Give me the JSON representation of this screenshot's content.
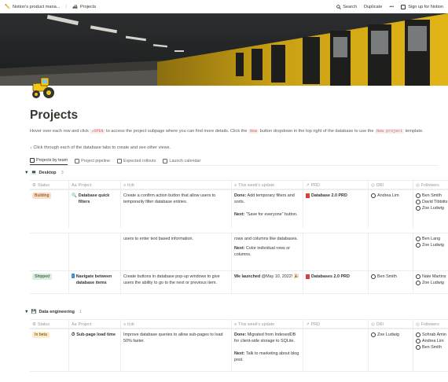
{
  "topbar": {
    "workspace": "Notion's product mana...",
    "page": "Projects",
    "search": "Search",
    "duplicate": "Duplicate",
    "more": "•••",
    "signup": "Sign up for Notion"
  },
  "title": "Projects",
  "description": {
    "part1": "Hover over each row and click ",
    "code_open": "↗OPEN",
    "part2": " to access the project subpage where you can find more details. Click the ",
    "code_new": "New",
    "part3": " button dropdown in the top right of the database to use the ",
    "code_template": "New project",
    "part4": " template."
  },
  "hint": "↓ Click through each of the database tabs to create and see other views.",
  "tabs": [
    {
      "label": "Projects by team"
    },
    {
      "label": "Project pipeline"
    },
    {
      "label": "Expected rollouts"
    },
    {
      "label": "Launch calendar"
    }
  ],
  "headers": {
    "status": "Status",
    "project": "Project",
    "tldr": "tl;dr",
    "update": "This week's update",
    "prd": "PRD",
    "dri": "DRI",
    "followers": "Followers"
  },
  "groups": [
    {
      "name": "Desktop",
      "count": "3"
    },
    {
      "name": "Data engineering",
      "count": "1"
    }
  ],
  "rows": [
    {
      "status": "Building",
      "project": "Database quick filters",
      "tldr": "Create a confirm action button that allow users to temporarily filter database entries.",
      "update_b1": "Done:",
      "update_t1": " Add temporary filters and sorts.",
      "update_b2": "Next:",
      "update_t2": " \"Save for everyone\" button.",
      "prd": "Database 2.0 PRD",
      "dri": "Andrea Lim",
      "followers": [
        "Ben Smith",
        "David Tibbitts",
        "Zoe Ludwig"
      ]
    },
    {
      "tldr": "users to enter text based information.",
      "update_t1": "rows and columns like databases.",
      "update_b2": "Next:",
      "update_t2": " Color individual rows or columns.",
      "followers": [
        "Ben Lang",
        "Zoe Ludwig"
      ]
    },
    {
      "status": "Shipped",
      "project": "Navigate between database items",
      "tldr": "Create buttons in database pop-up windows to give users the ability to go to the next or previous item.",
      "update_b1": "We launched",
      "update_t1": " @May 10, 2022! 🎉",
      "prd": "Databases 2.0 PRD",
      "dri": "Ben Smith",
      "followers": [
        "Nate Martins",
        "Zoe Ludwig"
      ]
    },
    {
      "status": "In beta",
      "project": "Sub-page load time",
      "tldr": "Improve database queries to allow sub-pages to load 50% faster.",
      "update_b1": "Done:",
      "update_t1": " Migrated from IndexedDB for client-side storage to SQLite.",
      "update_b2": "Next:",
      "update_t2": " Talk to marketing about blog post.",
      "dri": "Zoe Ludwig",
      "followers": [
        "Sohrab Amin",
        "Andrea Lim",
        "Ben Smith"
      ]
    }
  ]
}
